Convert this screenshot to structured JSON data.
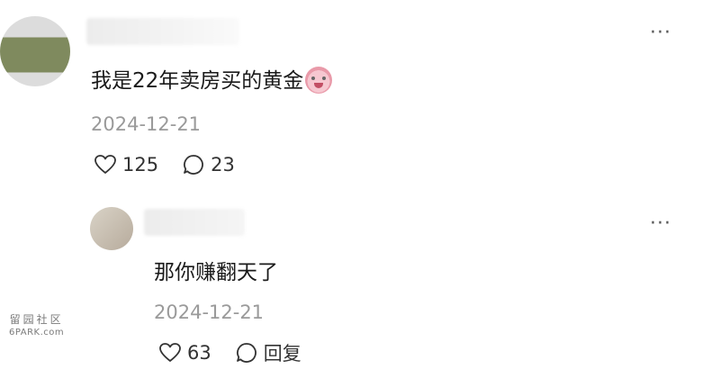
{
  "comment": {
    "text": "我是22年卖房买的黄金",
    "emoji_icon": "crying-face-emoji",
    "date": "2024-12-21",
    "likes": "125",
    "replies": "23"
  },
  "reply": {
    "text": "那你赚翻天了",
    "date": "2024-12-21",
    "likes": "63",
    "reply_label": "回复"
  },
  "menu_glyph": "···",
  "watermark": {
    "cn": "留园社区",
    "en": "6PARK.com"
  }
}
